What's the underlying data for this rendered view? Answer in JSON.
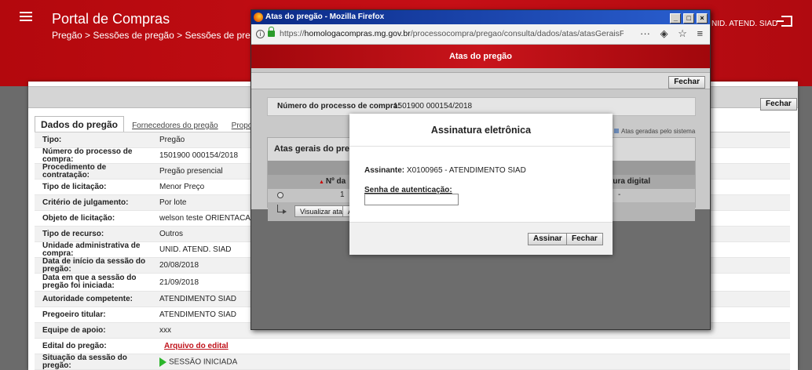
{
  "portal": {
    "title": "Portal de Compras",
    "breadcrumb": "Pregão > Sessões de pregão > Sessões de pregão pr",
    "unit_label": "NID. ATEND. SIAD",
    "fechar_label": "Fechar"
  },
  "tabs": [
    {
      "label": "Dados do pregão"
    },
    {
      "label": "Fornecedores do pregão"
    },
    {
      "label": "Propostas"
    }
  ],
  "details": [
    {
      "label": "Tipo:",
      "value": "Pregão"
    },
    {
      "label": "Número do processo de compra:",
      "value": "1501900 000154/2018"
    },
    {
      "label": "Procedimento de contratação:",
      "value": "Pregão presencial"
    },
    {
      "label": "Tipo de licitação:",
      "value": "Menor Preço"
    },
    {
      "label": "Critério de julgamento:",
      "value": "Por lote"
    },
    {
      "label": "Objeto de licitação:",
      "value": "welson teste ORIENTACAO FC"
    },
    {
      "label": "Tipo de recurso:",
      "value": "Outros"
    },
    {
      "label": "Unidade administrativa de compra:",
      "value": "UNID. ATEND. SIAD"
    },
    {
      "label": "Data de início da sessão do pregão:",
      "value": "20/08/2018"
    },
    {
      "label": "Data em que a sessão do pregão foi iniciada:",
      "value": "21/09/2018"
    },
    {
      "label": "Autoridade competente:",
      "value": "ATENDIMENTO SIAD"
    },
    {
      "label": "Pregoeiro titular:",
      "value": "ATENDIMENTO SIAD"
    },
    {
      "label": "Equipe de apoio:",
      "value": "xxx"
    },
    {
      "label": "Edital do pregão:",
      "value": "Arquivo do edital"
    },
    {
      "label": "Situação da sessão do pregão:",
      "value": "SESSÃO INICIADA"
    }
  ],
  "browser": {
    "window_title": "Atas do pregão - Mozilla Firefox",
    "url_prefix": "https://",
    "url_host": "homologacompras.mg.gov.br",
    "url_path": "/processocompra/pregao/consulta/dados/atas/atasGeraisPregao.html?",
    "win_min": "_",
    "win_max": "□",
    "win_close": "×",
    "more_glyph": "···",
    "pocket_glyph": "◈",
    "star_glyph": "☆",
    "menu_glyph": "≡",
    "info_glyph": "i"
  },
  "atas": {
    "header": "Atas do pregão",
    "fechar_label": "Fechar",
    "processo_label": "Número do processo de compra:",
    "processo_value": "1501900 000154/2018",
    "legend": "Atas geradas pelo sistema",
    "atas_gerais_title": "Atas gerais do pregão",
    "col_num": "Nº da",
    "col_assinatura": "tura digital",
    "row_num": "1",
    "row_dash": "-",
    "visualizar_label": "Visualizar ata",
    "a_label": "A"
  },
  "modal": {
    "title": "Assinatura eletrônica",
    "assinante_label": "Assinante:",
    "assinante_value": "X0100965 - ATENDIMENTO SIAD",
    "senha_label": "Senha de autenticação:",
    "senha_value": "",
    "assinar_label": "Assinar",
    "fechar_label": "Fechar"
  }
}
